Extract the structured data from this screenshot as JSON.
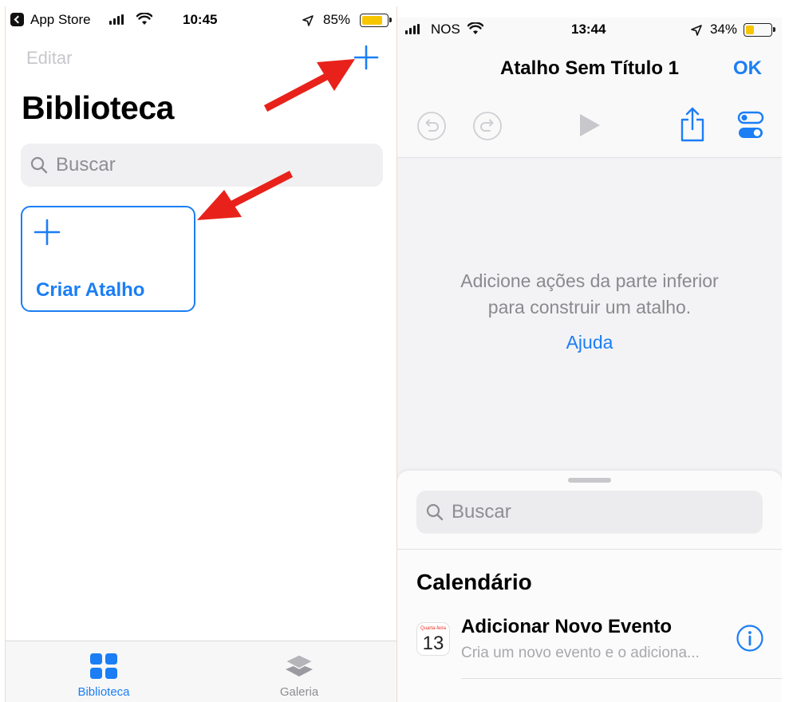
{
  "left_screen": {
    "status_bar": {
      "back_app": "App Store",
      "time": "10:45",
      "battery": "85%",
      "battery_level": 0.85
    },
    "nav": {
      "edit_label": "Editar"
    },
    "title": "Biblioteca",
    "search": {
      "placeholder": "Buscar"
    },
    "create_card": {
      "label": "Criar Atalho"
    },
    "tabs": [
      {
        "label": "Biblioteca",
        "icon": "grid-icon",
        "active": true
      },
      {
        "label": "Galeria",
        "icon": "layers-icon",
        "active": false
      }
    ],
    "colors": {
      "accent": "#1b7ef5",
      "annotation": "#e8221b"
    }
  },
  "right_screen": {
    "status_bar": {
      "carrier": "NOS",
      "time": "13:44",
      "battery": "34%",
      "battery_level": 0.34
    },
    "nav": {
      "title": "Atalho Sem Título 1",
      "ok_label": "OK"
    },
    "toolbar": [
      "undo-icon",
      "redo-icon",
      "play-icon",
      "share-icon",
      "settings-toggle-icon"
    ],
    "empty_state": {
      "line1": "Adicione ações da parte inferior",
      "line2": "para construir um atalho.",
      "help_label": "Ajuda"
    },
    "sheet": {
      "search_placeholder": "Buscar",
      "section": "Calendário",
      "calendar_icon_day": "Quarta-feira",
      "calendar_icon_date": "13",
      "action_title": "Adicionar Novo Evento",
      "action_desc": "Cria um novo evento e o adiciona..."
    }
  }
}
